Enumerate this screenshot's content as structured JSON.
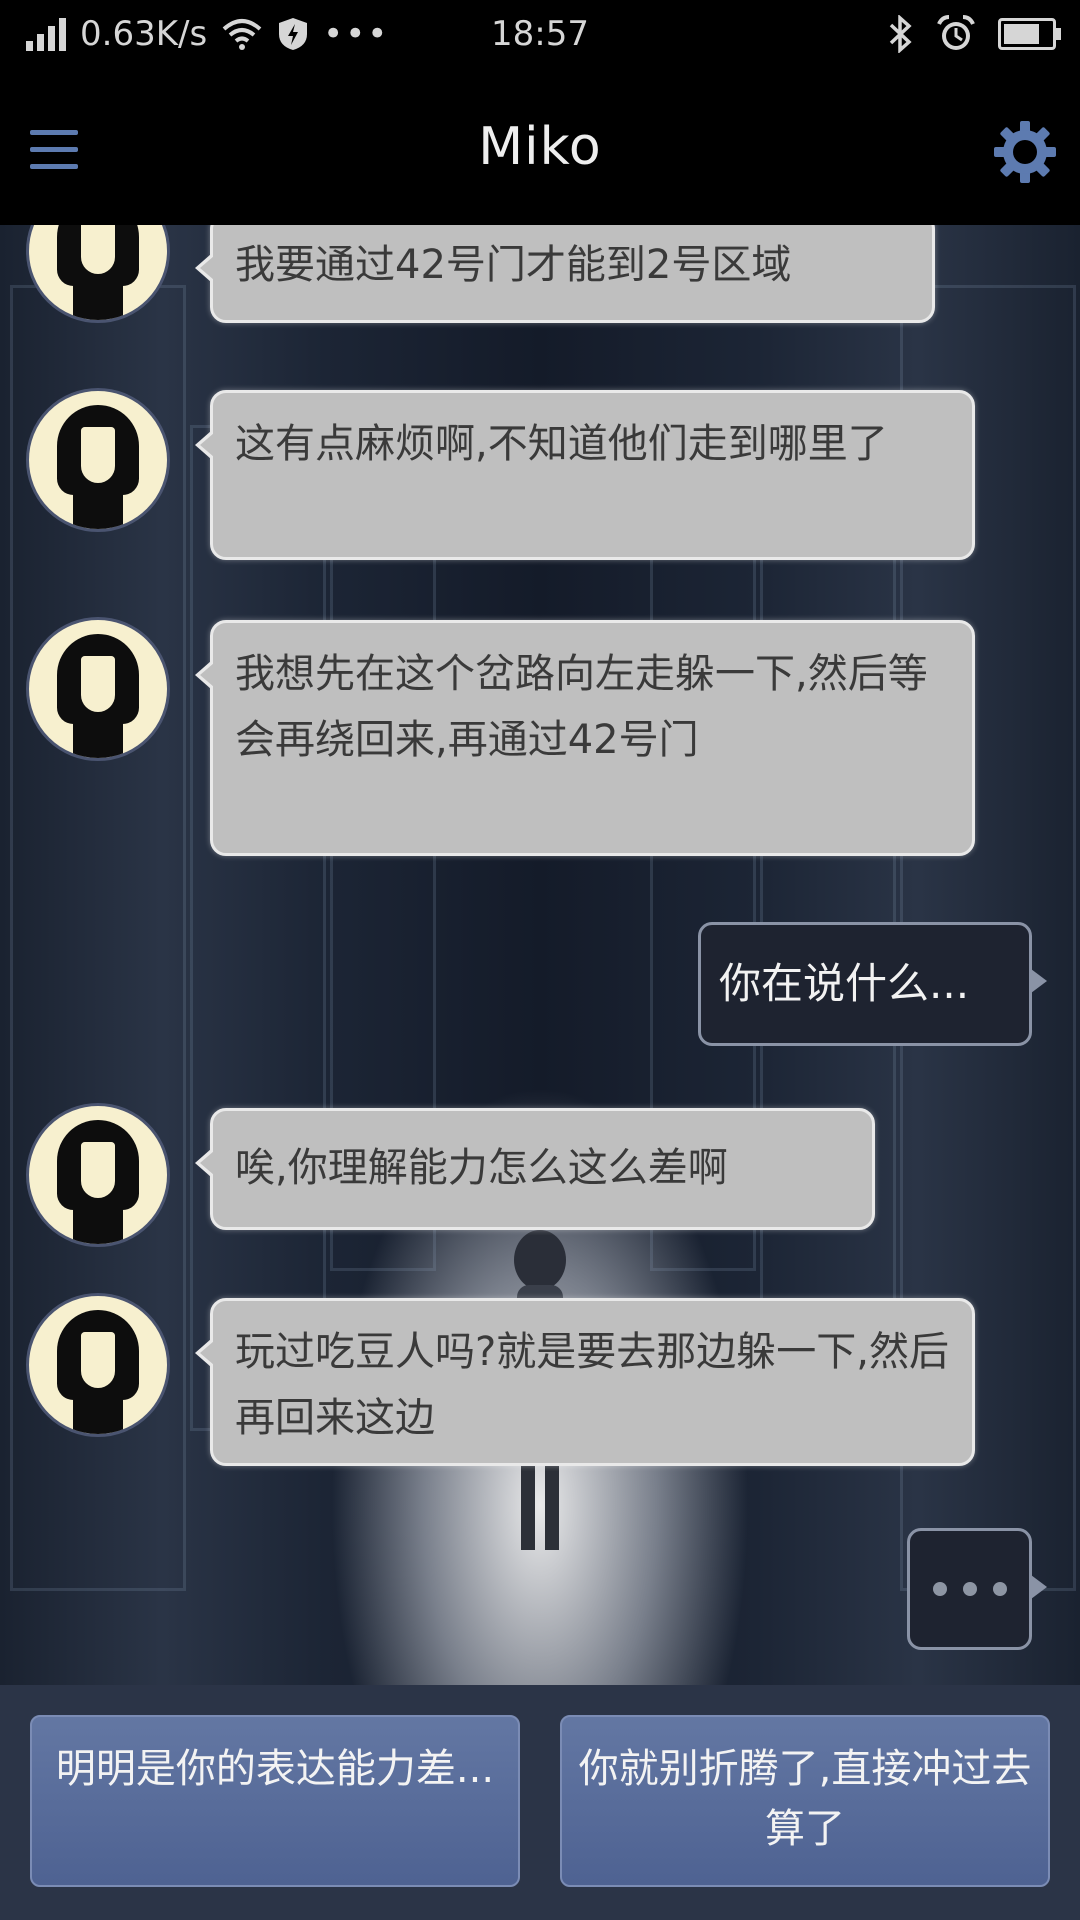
{
  "status_bar": {
    "speed": "0.63K/s",
    "time": "18:57",
    "icons": [
      "signal-icon",
      "wifi-icon",
      "shield-icon",
      "more-icon",
      "bluetooth-icon",
      "alarm-icon",
      "battery-icon"
    ]
  },
  "header": {
    "title": "Miko",
    "left_icon": "menu-icon",
    "right_icon": "gear-icon"
  },
  "messages": [
    {
      "from": "Miko",
      "text": "我要通过42号门才能到2号区域"
    },
    {
      "from": "Miko",
      "text": "这有点麻烦啊,不知道他们走到哪里了"
    },
    {
      "from": "Miko",
      "text": "我想先在这个岔路向左走躲一下,然后等会再绕回来,再通过42号门"
    },
    {
      "from": "user",
      "text": "你在说什么..."
    },
    {
      "from": "Miko",
      "text": "唉,你理解能力怎么这么差啊"
    },
    {
      "from": "Miko",
      "text": "玩过吃豆人吗?就是要去那边躲一下,然后再回来这边"
    },
    {
      "from": "user",
      "typing": true
    }
  ],
  "replies": [
    {
      "text": "明明是你的表达能力差..."
    },
    {
      "text": "你就别折腾了,直接冲过去算了"
    }
  ],
  "colors": {
    "header_bg": "#000000",
    "accent_icon": "#5d7bb0",
    "incoming_bubble": "#bfbfbf",
    "outgoing_bubble": "#1e2330",
    "reply_button": "#5a6d9b"
  }
}
